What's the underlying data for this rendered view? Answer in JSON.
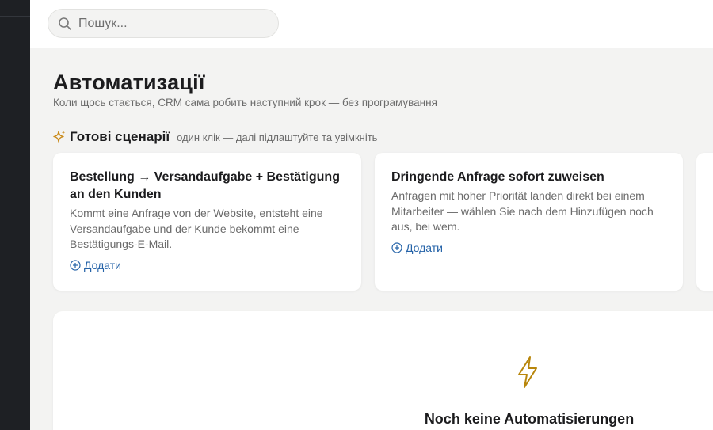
{
  "search": {
    "placeholder": "Пошук..."
  },
  "page": {
    "title": "Автоматизації",
    "subtitle": "Коли щось стається, CRM сама робить наступний крок — без програмування"
  },
  "templates_section": {
    "title": "Готові сценарії",
    "hint": "один клік — далі підлаштуйте та увімкніть",
    "cards": [
      {
        "title": "Bestellung → Versandaufgabe + Bestätigung an den Kunden",
        "description": "Kommt eine Anfrage von der Website, entsteht eine Versandaufgabe und der Kunde bekommt eine Bestätigungs-E-Mail.",
        "add_label": "Додати"
      },
      {
        "title": "Dringende Anfrage sofort zuweisen",
        "description": "Anfragen mit hoher Priorität landen direkt bei einem Mitarbeiter — wählen Sie nach dem Hinzufügen noch aus, bei wem.",
        "add_label": "Додати"
      }
    ]
  },
  "empty_state": {
    "icon": "lightning-icon",
    "title": "Noch keine Automatisierungen"
  },
  "colors": {
    "accent": "#2563a8",
    "sparkle": "#c98a1a",
    "bolt": "#b8860b",
    "sidebar": "#1e2024"
  }
}
